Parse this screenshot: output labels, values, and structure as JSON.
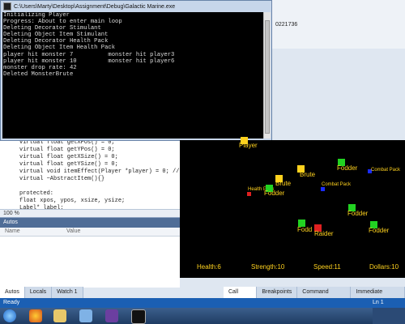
{
  "console": {
    "title": "C:\\Users\\Marty\\Desktop\\Assignment\\Debug\\Galactic Marine.exe",
    "lines": [
      "Initializing Player",
      "Progress: About to enter main loop",
      "Deleting Decorator Stimulant",
      "Deleting Object Item Stimulant",
      "Deleting Decorator Health Pack",
      "Deleting Object Item Health Pack",
      "player hit monster 7          monster hit player3",
      "player hit monster 10         monster hit player6",
      "monster drop rate: 42",
      "Deleted MonsterBrute"
    ]
  },
  "ide_number": "0221736",
  "code": {
    "lines": [
      "virtual float getXPos() = 0;",
      "virtual float getYPos() = 0;",
      "virtual float getXSize() = 0;",
      "virtual float getYSize() = 0;",
      "virtual void itemEffect(Player *player) = 0; // used",
      "virtual ~AbstractItem(){}",
      "",
      "protected:",
      "float xpos, ypos, xsize, ysize;",
      "Label* label;"
    ],
    "zoom": "100 %"
  },
  "autos": {
    "title": "Autos",
    "col_name": "Name",
    "col_value": "Value"
  },
  "left_tabs": [
    "Autos",
    "Locals",
    "Watch 1"
  ],
  "right_tabs": [
    "Call Stack",
    "Breakpoints",
    "Command Window",
    "Immediate Window"
  ],
  "status": {
    "left": "Ready",
    "right": "Ln 1"
  },
  "game": {
    "objects": [
      {
        "label": "Player",
        "color": "#ffd21e",
        "label_color": "#ffd21e"
      },
      {
        "label": "Fodder",
        "color": "#22d322",
        "label_color": "#ffd21e"
      },
      {
        "label": "Combat Pack",
        "color": "#1a2cff",
        "label_color": "#ffd21e"
      },
      {
        "label": "Brute",
        "color": "#ffd21e",
        "label_color": "#ffd21e"
      },
      {
        "label": "Brute",
        "color": "#ffd21e",
        "label_color": "#ffd21e"
      },
      {
        "label": "Combat Pack",
        "color": "#1a2cff",
        "label_color": "#ffd21e"
      },
      {
        "label": "Health Pack",
        "color": "#e02020",
        "label_color": "#ffd21e"
      },
      {
        "label": "Fodder",
        "color": "#22d322",
        "label_color": "#ffd21e"
      },
      {
        "label": "Fodder",
        "color": "#22d322",
        "label_color": "#ffd21e"
      },
      {
        "label": "Fodder",
        "color": "#22d322",
        "label_color": "#ffd21e"
      },
      {
        "label": "Fodd",
        "color": "#22d322",
        "label_color": "#ffd21e"
      },
      {
        "label": "Raider",
        "color": "#e02020",
        "label_color": "#ffd21e"
      }
    ],
    "hud": {
      "health": "Health:6",
      "strength": "Strength:10",
      "speed": "Speed:11",
      "dollars": "Dollars:10"
    }
  },
  "taskbar_icons": [
    "start-orb-icon",
    "firefox-icon",
    "explorer-folder-icon",
    "photos-icon",
    "visual-studio-icon",
    "game-app-icon"
  ]
}
